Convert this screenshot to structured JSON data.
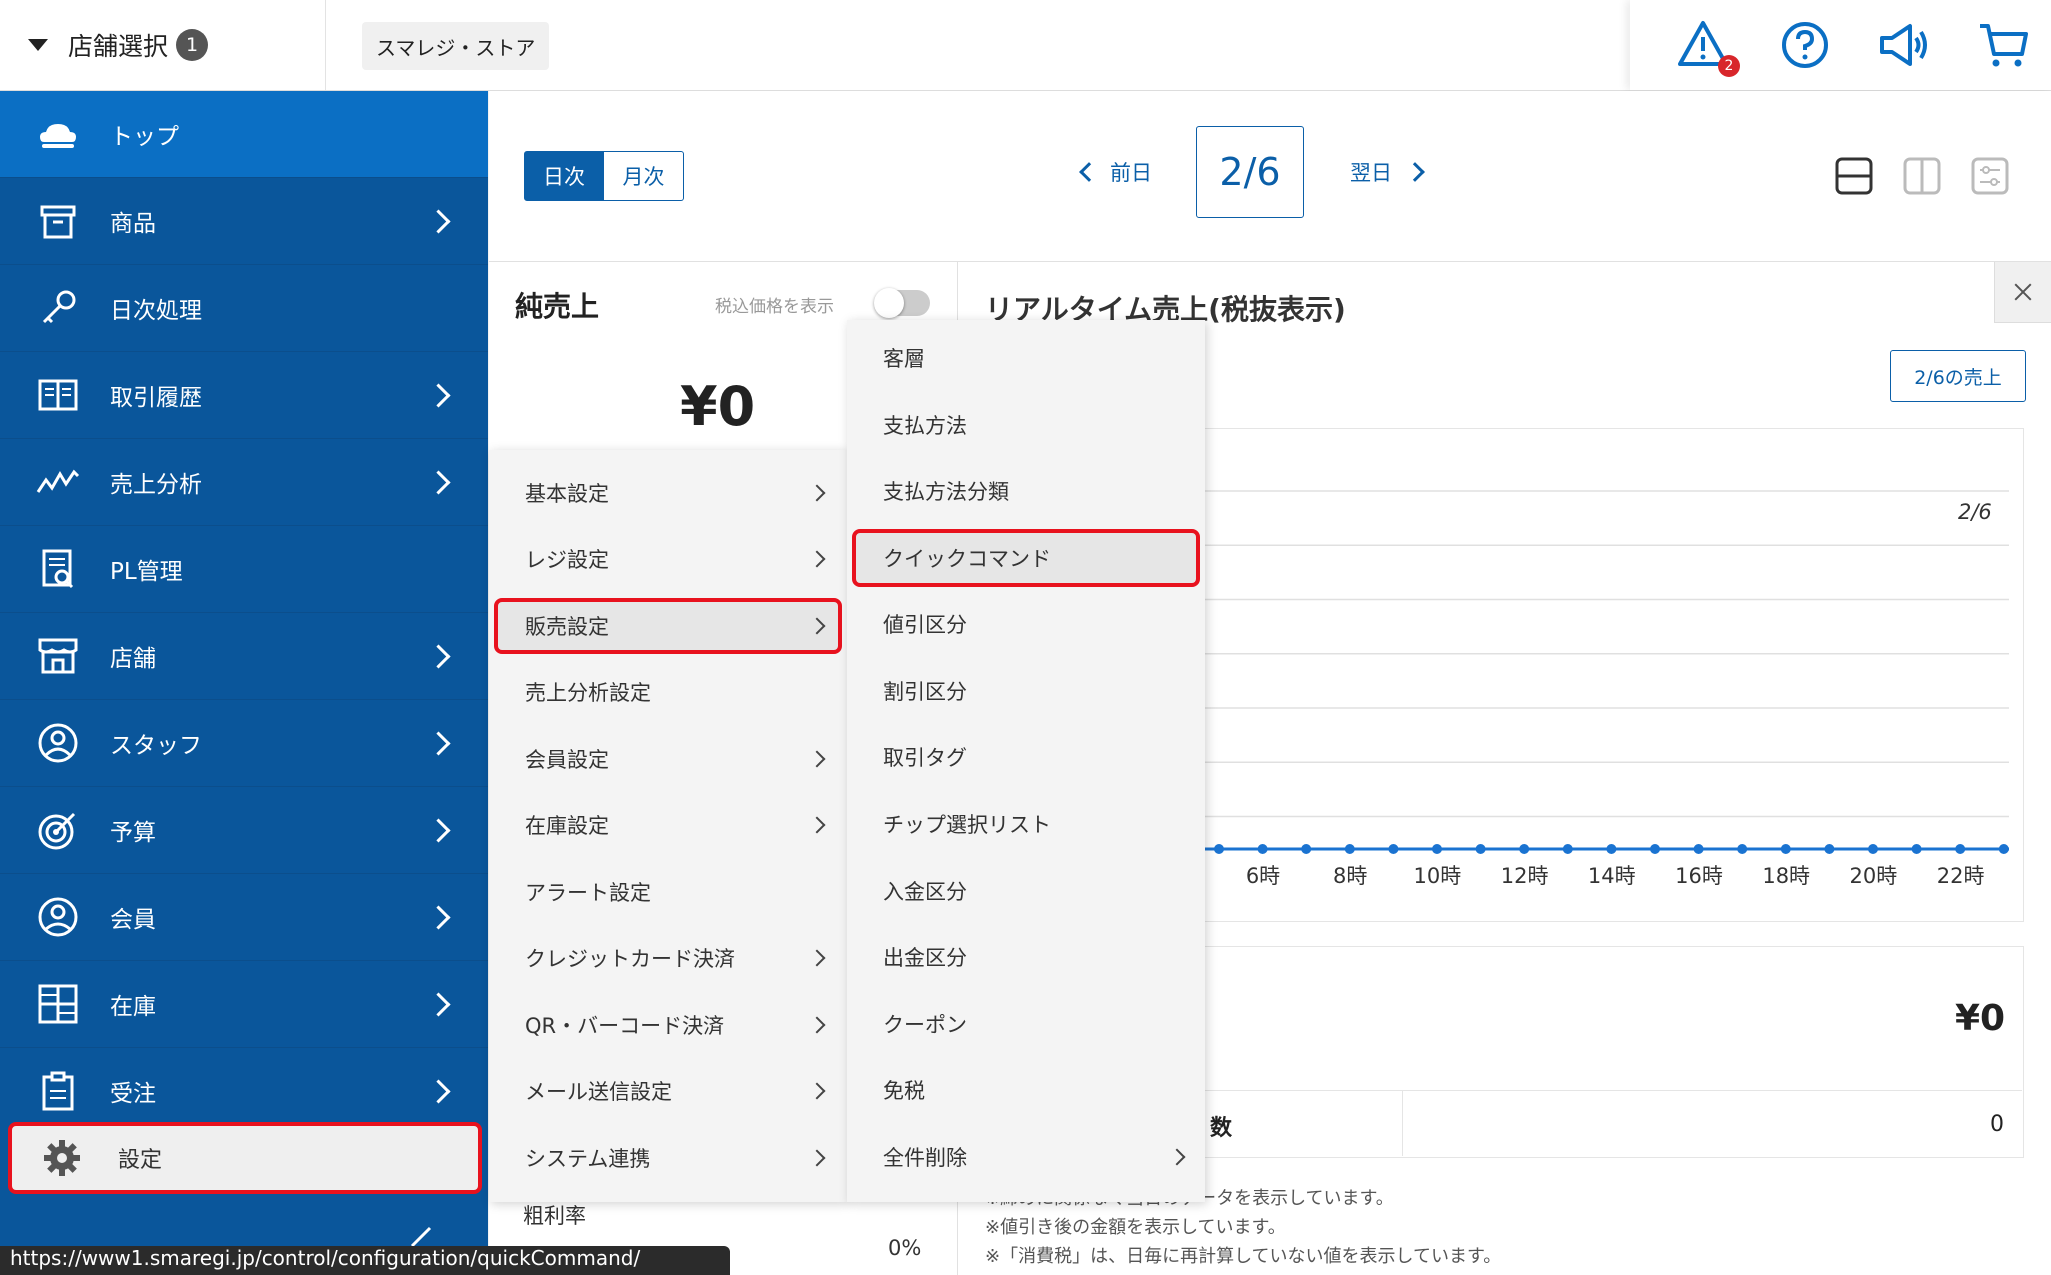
{
  "header": {
    "store_select_label": "店舗選択",
    "store_select_count": "1",
    "store_name": "スマレジ・ストア",
    "alert_count": "2"
  },
  "sidebar": {
    "items": [
      {
        "label": "トップ",
        "icon": "cloud-icon"
      },
      {
        "label": "商品",
        "icon": "box-icon"
      },
      {
        "label": "日次処理",
        "icon": "key-icon"
      },
      {
        "label": "取引履歴",
        "icon": "book-icon"
      },
      {
        "label": "売上分析",
        "icon": "trend-icon"
      },
      {
        "label": "PL管理",
        "icon": "report-icon"
      },
      {
        "label": "店舗",
        "icon": "store-icon"
      },
      {
        "label": "スタッフ",
        "icon": "staff-icon"
      },
      {
        "label": "予算",
        "icon": "target-icon"
      },
      {
        "label": "会員",
        "icon": "member-icon"
      },
      {
        "label": "在庫",
        "icon": "inventory-icon"
      },
      {
        "label": "受注",
        "icon": "clipboard-icon"
      }
    ],
    "settings_label": "設定"
  },
  "toolbar": {
    "day_label": "日次",
    "month_label": "月次",
    "prev_label": "前日",
    "next_label": "翌日",
    "current_date": "2/6"
  },
  "net_sales": {
    "title": "純売上",
    "tax_toggle_label": "税込価格を表示",
    "value": "¥0",
    "gross_margin_label": "粗利率",
    "gross_margin_value": "0%"
  },
  "realtime": {
    "title": "リアルタイム売上(税抜表示)",
    "sales_button": "2/6の売上",
    "legend": "2/6",
    "x_ticks": [
      "6時",
      "8時",
      "10時",
      "12時",
      "14時",
      "16時",
      "18時",
      "20時",
      "22時"
    ],
    "total_value": "¥0",
    "count_label": "数",
    "count_value": "0",
    "notes": [
      "※締めに関係なく当日のデータを表示しています。",
      "※値引き後の金額を表示しています。",
      "※「消費税」は、日毎に再計算していない値を表示しています。"
    ]
  },
  "menu_level1": [
    {
      "label": "基本設定",
      "has_sub": true
    },
    {
      "label": "レジ設定",
      "has_sub": true
    },
    {
      "label": "販売設定",
      "has_sub": true
    },
    {
      "label": "売上分析設定",
      "has_sub": false
    },
    {
      "label": "会員設定",
      "has_sub": true
    },
    {
      "label": "在庫設定",
      "has_sub": true
    },
    {
      "label": "アラート設定",
      "has_sub": false
    },
    {
      "label": "クレジットカード決済",
      "has_sub": true
    },
    {
      "label": "QR・バーコード決済",
      "has_sub": true
    },
    {
      "label": "メール送信設定",
      "has_sub": true
    },
    {
      "label": "システム連携",
      "has_sub": true
    }
  ],
  "menu_level2": [
    {
      "label": "客層",
      "has_sub": false
    },
    {
      "label": "支払方法",
      "has_sub": false
    },
    {
      "label": "支払方法分類",
      "has_sub": false
    },
    {
      "label": "クイックコマンド",
      "has_sub": false
    },
    {
      "label": "値引区分",
      "has_sub": false
    },
    {
      "label": "割引区分",
      "has_sub": false
    },
    {
      "label": "取引タグ",
      "has_sub": false
    },
    {
      "label": "チップ選択リスト",
      "has_sub": false
    },
    {
      "label": "入金区分",
      "has_sub": false
    },
    {
      "label": "出金区分",
      "has_sub": false
    },
    {
      "label": "クーポン",
      "has_sub": false
    },
    {
      "label": "免税",
      "has_sub": false
    },
    {
      "label": "全件削除",
      "has_sub": true
    }
  ],
  "status_url": "https://www1.smaregi.jp/control/configuration/quickCommand/",
  "colors": {
    "sidebar": "#0a569b",
    "sidebar_active": "#0b6fc4",
    "accent": "#0b5fa8",
    "highlight": "#e8121e",
    "chart_line": "#1a73d1"
  }
}
